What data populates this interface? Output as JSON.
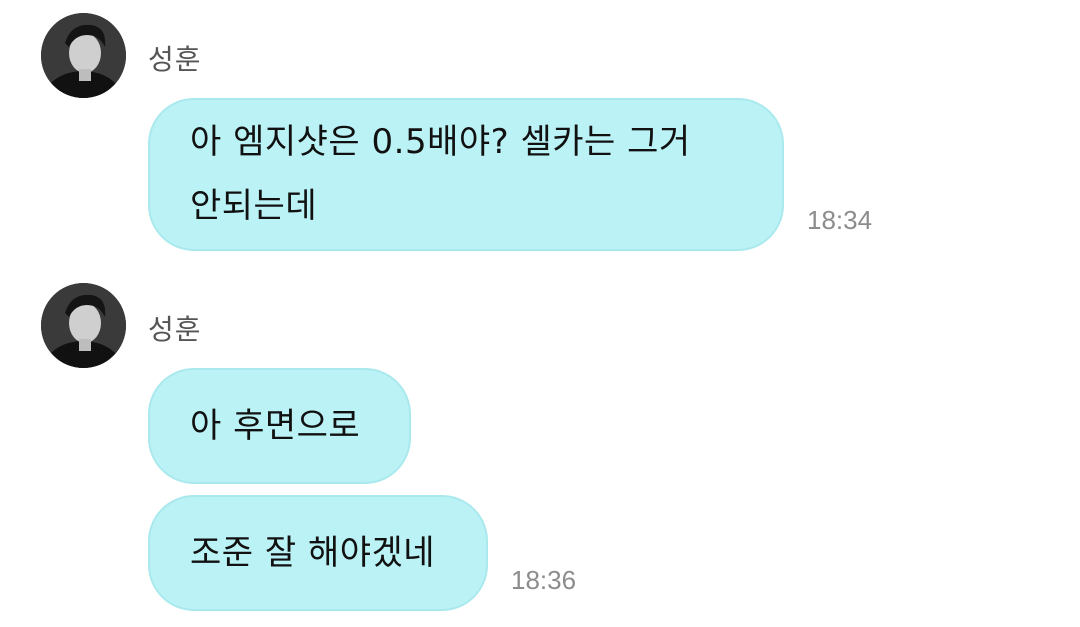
{
  "messages": [
    {
      "sender": "성훈",
      "avatar": "profile-photo-avatar",
      "bubbles": [
        {
          "lines": [
            "아 엠지샷은 0.5배야? 셀카는 그거",
            "안되는데"
          ]
        }
      ],
      "time": "18:34"
    },
    {
      "sender": "성훈",
      "avatar": "profile-photo-avatar",
      "bubbles": [
        {
          "lines": [
            "아 후면으로"
          ]
        },
        {
          "lines": [
            "조준 잘 해야겠네"
          ]
        }
      ],
      "time": "18:36"
    }
  ],
  "colors": {
    "bubble": "#bbf2f5",
    "bubble_border": "#a9e9ee",
    "time": "#8c8c8c",
    "sender": "#555555"
  }
}
